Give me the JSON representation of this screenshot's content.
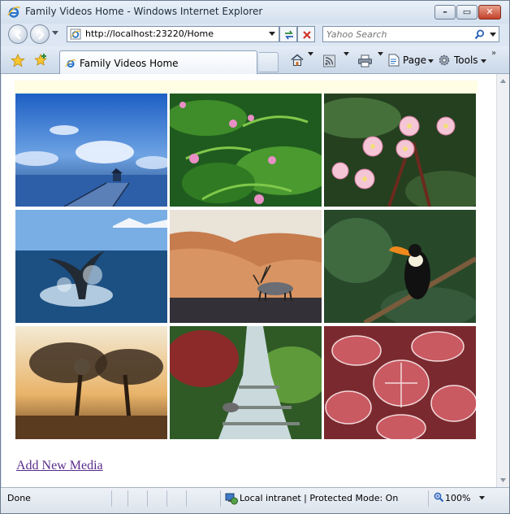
{
  "window": {
    "title": "Family Videos Home - Windows Internet Explorer",
    "icon": "internet-explorer-icon"
  },
  "address_bar": {
    "url": "http://localhost:23220/Home"
  },
  "search": {
    "placeholder": "Yahoo Search"
  },
  "tab": {
    "label": "Family Videos Home"
  },
  "commands": {
    "page_label": "Page",
    "tools_label": "Tools"
  },
  "gallery": {
    "thumbnails": [
      {
        "subject": "pier-at-sunset"
      },
      {
        "subject": "pink-flowers-and-ferns"
      },
      {
        "subject": "pink-frangipani-flowers"
      },
      {
        "subject": "whale-tail"
      },
      {
        "subject": "oryx-in-desert"
      },
      {
        "subject": "toucan-on-branch"
      },
      {
        "subject": "trees-at-sunrise"
      },
      {
        "subject": "garden-waterfall"
      },
      {
        "subject": "frosted-red-leaves"
      }
    ]
  },
  "links": {
    "add_new_media": "Add New Media"
  },
  "status_bar": {
    "status": "Done",
    "zone": "Local intranet | Protected Mode: On",
    "zoom": "100%"
  },
  "colors": {
    "visited_link": "#5b2c8c",
    "banner": "#fffde3",
    "chrome": "#dce7f3"
  }
}
